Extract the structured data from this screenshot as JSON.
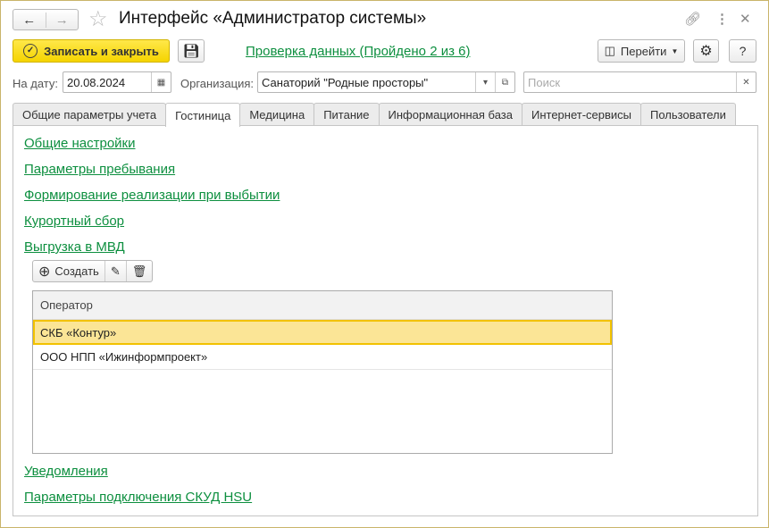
{
  "window": {
    "title": "Интерфейс «Администратор системы»"
  },
  "toolbar": {
    "save_close": "Записать и закрыть",
    "check_link": "Проверка данных (Пройдено 2 из 6)",
    "goto": "Перейти",
    "help": "?"
  },
  "filters": {
    "date_label": "На дату:",
    "date_value": "20.08.2024",
    "org_label": "Организация:",
    "org_value": "Санаторий \"Родные просторы\"",
    "search_placeholder": "Поиск"
  },
  "tabs": [
    "Общие параметры учета",
    "Гостиница",
    "Медицина",
    "Питание",
    "Информационная база",
    "Интернет-сервисы",
    "Пользователи"
  ],
  "links": [
    "Общие настройки",
    "Параметры пребывания",
    "Формирование реализации при выбытии",
    "Курортный сбор",
    "Выгрузка в МВД"
  ],
  "links_bottom": [
    "Уведомления",
    "Параметры подключения СКУД HSU"
  ],
  "table": {
    "create": "Создать",
    "header": "Оператор",
    "rows": [
      "СКБ «Контур»",
      "ООО НПП «Ижинформпроект»"
    ]
  }
}
